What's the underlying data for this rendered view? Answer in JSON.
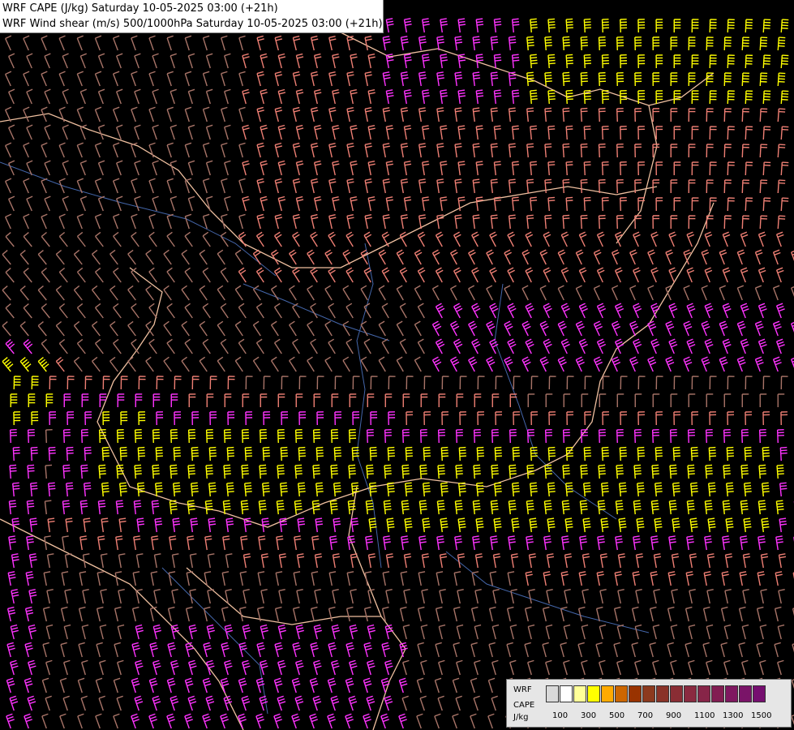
{
  "header": {
    "line1": "WRF CAPE (J/kg) Saturday 10-05-2025 03:00 (+21h)",
    "line2": "WRF Wind shear (m/s) 500/1000hPa Saturday 10-05-2025 03:00 (+21h)"
  },
  "legend": {
    "label_model": "WRF",
    "label_field": "CAPE",
    "label_unit": "J/kg",
    "colors": [
      "#d9d9d9",
      "#ffffff",
      "#ffff99",
      "#ffff00",
      "#ffaa00",
      "#cc6600",
      "#993300",
      "#8c3a1e",
      "#8a3328",
      "#8a2d34",
      "#8a2a40",
      "#872548",
      "#821d52",
      "#7f1860",
      "#7a1468",
      "#760f70"
    ],
    "ticks": [
      "100",
      "300",
      "500",
      "700",
      "900",
      "1100",
      "1300",
      "1500"
    ]
  },
  "map": {
    "barb_colors": {
      "weak": "#a87468",
      "moderate": "#ee7f74",
      "strong": "#ff33ff",
      "very_strong": "#ffff00"
    },
    "border_color": "#f0c0a0",
    "river_color": "#4466aa"
  }
}
